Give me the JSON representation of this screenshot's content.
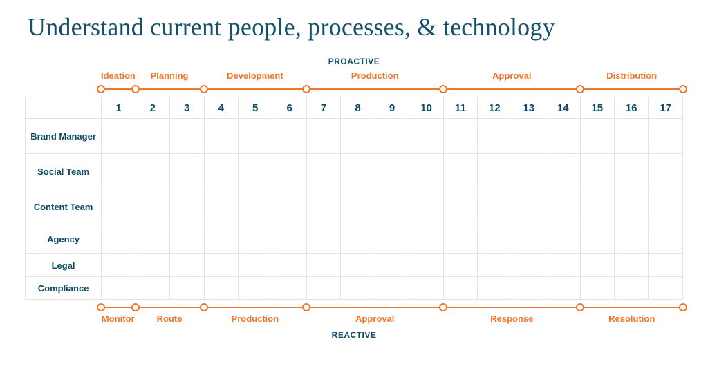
{
  "title": "Understand current people, processes, & technology",
  "top_section_label": "PROACTIVE",
  "bottom_section_label": "REACTIVE",
  "columns": [
    "1",
    "2",
    "3",
    "4",
    "5",
    "6",
    "7",
    "8",
    "9",
    "10",
    "11",
    "12",
    "13",
    "14",
    "15",
    "16",
    "17"
  ],
  "rows": [
    {
      "label": "Brand Manager",
      "size": "tall"
    },
    {
      "label": "Social Team",
      "size": "tall"
    },
    {
      "label": "Content Team",
      "size": "tall"
    },
    {
      "label": "Agency",
      "size": ""
    },
    {
      "label": "Legal",
      "size": "short"
    },
    {
      "label": "Compliance",
      "size": "short"
    }
  ],
  "top_phases": [
    {
      "label": "Ideation",
      "start": 0,
      "end": 1
    },
    {
      "label": "Planning",
      "start": 1,
      "end": 3
    },
    {
      "label": "Development",
      "start": 3,
      "end": 6
    },
    {
      "label": "Production",
      "start": 6,
      "end": 10
    },
    {
      "label": "Approval",
      "start": 10,
      "end": 14
    },
    {
      "label": "Distribution",
      "start": 14,
      "end": 17
    }
  ],
  "bottom_phases": [
    {
      "label": "Monitor",
      "start": 0,
      "end": 1
    },
    {
      "label": "Route",
      "start": 1,
      "end": 3
    },
    {
      "label": "Production",
      "start": 3,
      "end": 6
    },
    {
      "label": "Approval",
      "start": 6,
      "end": 10
    },
    {
      "label": "Response",
      "start": 10,
      "end": 14
    },
    {
      "label": "Resolution",
      "start": 14,
      "end": 17
    }
  ],
  "colors": {
    "accent": "#f0762c",
    "navy": "#0d4a66"
  }
}
